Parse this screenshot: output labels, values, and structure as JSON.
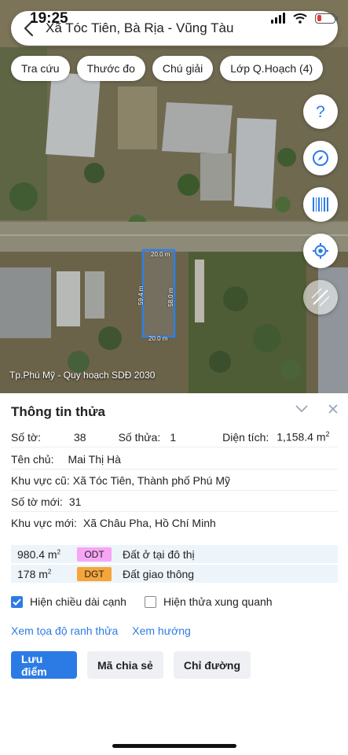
{
  "status_bar": {
    "time": "19:25",
    "battery_level": 0.28
  },
  "search": {
    "title": "Xã Tóc Tiên, Bà Rịa - Vũng Tàu"
  },
  "chips": [
    "Tra cứu",
    "Thước đo",
    "Chú giải",
    "Lớp Q.Hoạch (4)"
  ],
  "map": {
    "caption": "Tp.Phú Mỹ - Quy hoạch SDĐ 2030",
    "dims": {
      "top": "20.0 m",
      "bottom": "20.0 m",
      "left": "59.4 m",
      "right": "58.0 m"
    },
    "side_buttons": [
      "help-icon",
      "compass-icon",
      "barcode-icon",
      "locate-icon",
      "map-style-icon"
    ],
    "parcel_color": "#2f7fe8"
  },
  "sheet": {
    "title": "Thông tin thửa",
    "so_to_label": "Số tờ:",
    "so_to": "38",
    "so_thua_label": "Số thửa:",
    "so_thua": "1",
    "dien_tich_label": "Diện tích:",
    "dien_tich_value": "1,158.4 m",
    "dien_tich_sup": "2",
    "chu_label": "Tên chủ:",
    "chu": "Mai Thị Hà",
    "kv_cu_label": "Khu vực cũ:",
    "kv_cu": "Xã Tóc Tiên, Thành phố Phú Mỹ",
    "so_to_moi_label": "Số tờ mới:",
    "so_to_moi": "31",
    "kv_moi_label": "Khu vực mới:",
    "kv_moi": "Xã Châu Pha, Hồ Chí Minh"
  },
  "land_use": [
    {
      "area": "980.4 m",
      "sup": "2",
      "code": "ODT",
      "desc": "Đất ở tại đô thị",
      "color": "#f7a6f5"
    },
    {
      "area": "178 m",
      "sup": "2",
      "code": "DGT",
      "desc": "Đất giao thông",
      "color": "#f5a53a"
    }
  ],
  "options": {
    "show_edge_length": {
      "label": "Hiện chiều dài cạnh",
      "checked": true
    },
    "show_neighbors": {
      "label": "Hiện thửa xung quanh",
      "checked": false
    }
  },
  "links": {
    "coords": "Xem tọa độ ranh thửa",
    "direction": "Xem hướng"
  },
  "buttons": {
    "save": "Lưu điểm",
    "share": "Mã chia sẻ",
    "route": "Chỉ đường"
  },
  "colors": {
    "accent": "#2c7be5"
  }
}
